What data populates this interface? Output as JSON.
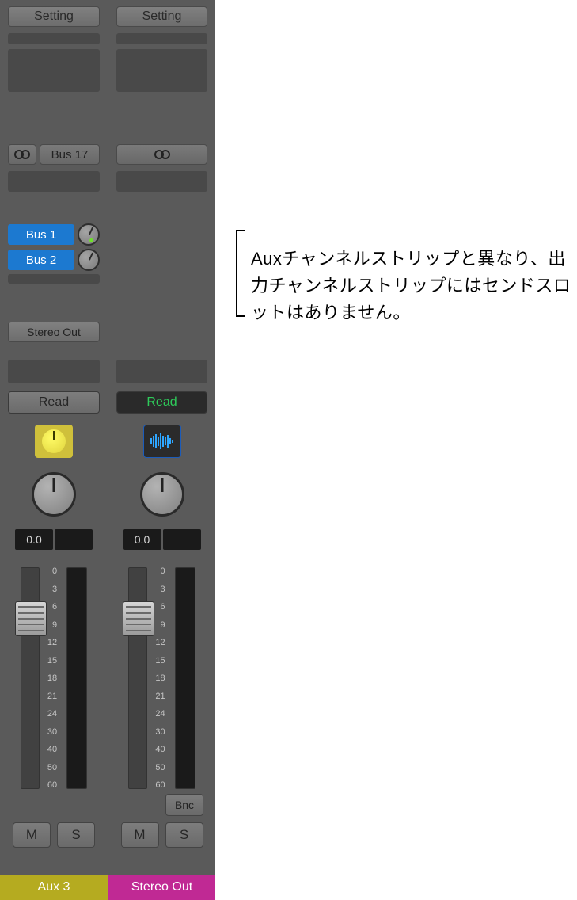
{
  "strips": [
    {
      "setting_label": "Setting",
      "io_label": "Bus 17",
      "sends": [
        {
          "label": "Bus 1",
          "active": true
        },
        {
          "label": "Bus 2",
          "active": false
        }
      ],
      "output_label": "Stereo Out",
      "automation_label": "Read",
      "readout_value": "0.0",
      "mute_label": "M",
      "solo_label": "S",
      "name": "Aux 3",
      "name_color": "#b5ab20"
    },
    {
      "setting_label": "Setting",
      "io_label": "",
      "sends": [],
      "output_label": "",
      "automation_label": "Read",
      "readout_value": "0.0",
      "bounce_label": "Bnc",
      "mute_label": "M",
      "solo_label": "S",
      "name": "Stereo Out",
      "name_color": "#c02994"
    }
  ],
  "fader_scale": [
    "0",
    "3",
    "6",
    "9",
    "12",
    "15",
    "18",
    "21",
    "24",
    "30",
    "40",
    "50",
    "60"
  ],
  "annotation_text": "Auxチャンネルストリップと異なり、出力チャンネルストリップにはセンドスロットはありません。"
}
